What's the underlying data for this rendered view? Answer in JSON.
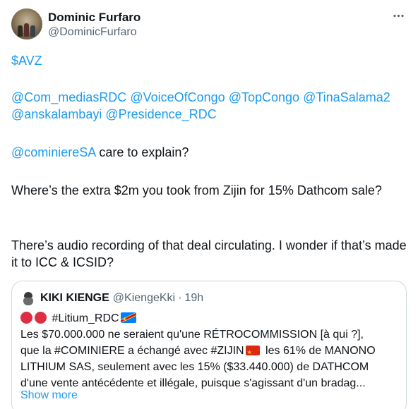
{
  "author": {
    "display_name": "Dominic Furfaro",
    "handle": "@DominicFurfaro"
  },
  "tweet": {
    "cashtag": "$AVZ",
    "mentions": [
      "@Com_mediasRDC",
      "@VoiceOfCongo",
      "@TopCongo",
      "@TinaSalama2",
      "@anskalambayi",
      "@Presidence_RDC"
    ],
    "cominiere_mention": "@cominiereSA",
    "cominiere_rest": " care to explain?",
    "para_where": "Where’s the extra $2m you took from Zijin for 15% Dathcom sale?",
    "para_audio": "There’s audio recording of that deal circulating. I wonder if that’s made it to ICC & ICSID?"
  },
  "quote": {
    "display_name": "KIKI KIENGE",
    "handle": "@KiengeKki",
    "separator": "·",
    "time": "19h",
    "hashtag_line": "#Litium_RDC",
    "line1": "Les $70.000.000 ne seraient qu'une RÉTROCOMMISSION [à qui ?],",
    "line2a": "que la #COMINIERE a échangé avec #ZIJIN",
    "line2b": " les 61% de MANONO",
    "line3": "LITHIUM SAS, seulement avec les 15% ($33.440.000) de DATHCOM",
    "line4": "d'une vente antécédente et illégale, puisque s'agissant d'un bradag...",
    "show_more": "Show more"
  },
  "icons": {
    "more": "more-horizontal-icon",
    "red_circle": "red-circle-emoji",
    "flag_drc": "flag-drc-emoji",
    "flag_china": "flag-china-emoji"
  },
  "colors": {
    "link": "#1d9bf0",
    "text": "#0f1419",
    "secondary": "#536471",
    "border": "#cfd9de"
  }
}
